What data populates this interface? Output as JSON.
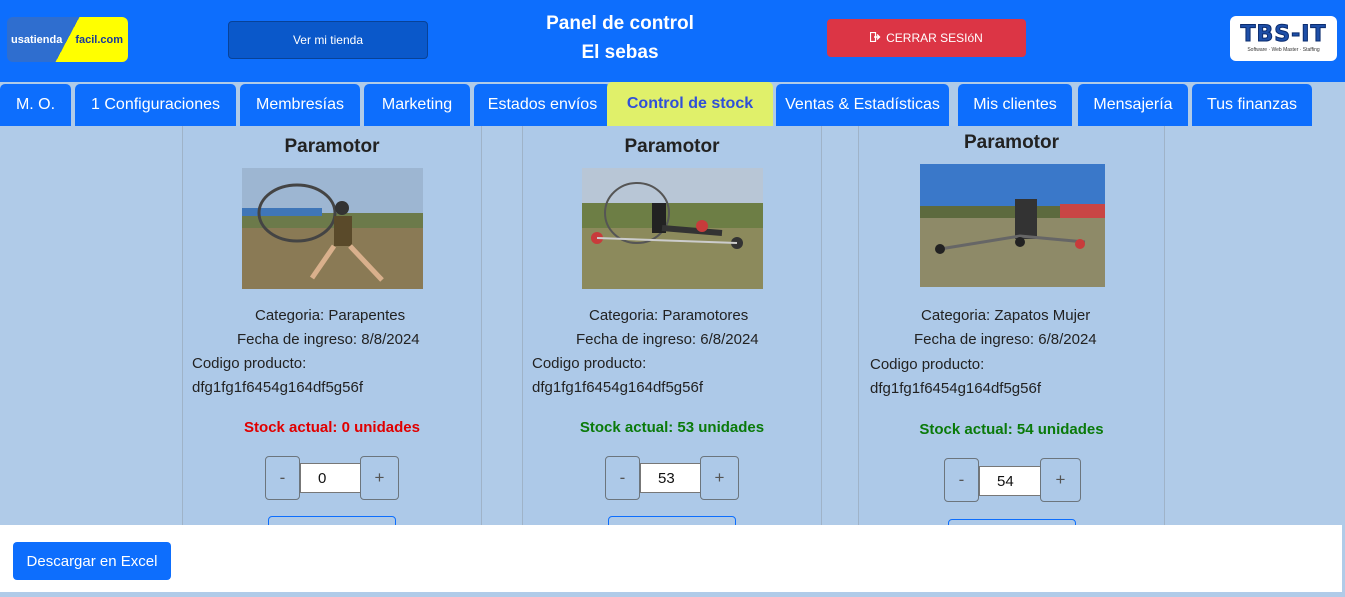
{
  "header": {
    "logo_left": {
      "part1": "usatienda",
      "part2": "facil.com"
    },
    "view_store_label": "Ver mi tienda",
    "title_line1": "Panel de control",
    "title_line2": "El sebas",
    "logout_label": "CERRAR SESIóN",
    "logo_right": {
      "main": "TBS-IT",
      "tagline": "Software · Web Master · Staffing"
    }
  },
  "tabs": [
    {
      "label": "M. O."
    },
    {
      "label": "1 Configuraciones"
    },
    {
      "label": "Membresías"
    },
    {
      "label": "Marketing"
    },
    {
      "label": "Estados envíos"
    },
    {
      "label": "Control de stock",
      "active": true
    },
    {
      "label": "Ventas & Estadísticas"
    },
    {
      "label": "Mis clientes"
    },
    {
      "label": "Mensajería"
    },
    {
      "label": "Tus finanzas"
    }
  ],
  "products": [
    {
      "name": "Paramotor",
      "category": "Categoria: Parapentes",
      "date": "Fecha de ingreso: 8/8/2024",
      "code_label": "Codigo producto:",
      "code": "dfg1fg1f6454g164df5g56f",
      "stock_text": "Stock actual: 0 unidades",
      "stock_color": "#e00000",
      "qty": "0"
    },
    {
      "name": "Paramotor",
      "category": "Categoria: Paramotores",
      "date": "Fecha de ingreso: 6/8/2024",
      "code_label": "Codigo producto:",
      "code": "dfg1fg1f6454g164df5g56f",
      "stock_text": "Stock actual: 53 unidades",
      "stock_color": "#0a7a0a",
      "qty": "53"
    },
    {
      "name": "Paramotor",
      "category": "Categoria: Zapatos Mujer",
      "date": "Fecha de ingreso: 6/8/2024",
      "code_label": "Codigo producto:",
      "code": "dfg1fg1f6454g164df5g56f",
      "stock_text": "Stock actual: 54 unidades",
      "stock_color": "#0a7a0a",
      "qty": "54"
    }
  ],
  "stepper": {
    "minus": "-",
    "plus": "+"
  },
  "footer": {
    "excel_label": "Descargar en Excel"
  },
  "colors": {
    "primary": "#0d6efd",
    "danger": "#dc3545",
    "active_tab": "#e0f06a",
    "page_bg": "#b0cbe8"
  }
}
